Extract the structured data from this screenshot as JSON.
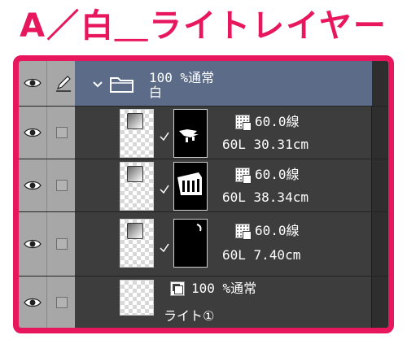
{
  "title": "A／白＿ライトレイヤー",
  "folder": {
    "opacity_blend": "100 %通常",
    "name": "白"
  },
  "layers": [
    {
      "line_width": "60.0線",
      "size_info": "60L 30.31cm"
    },
    {
      "line_width": "60.0線",
      "size_info": "60L 38.34cm"
    },
    {
      "line_width": "60.0線",
      "size_info": "60L 7.40cm"
    }
  ],
  "raster_layer": {
    "opacity_blend": "100 %通常",
    "name": "ライト①"
  },
  "colors": {
    "accent_frame": "#e8175d",
    "folder_row_bg": "#5b6b88",
    "panel_bg": "#3d3d3d",
    "column_bg": "#a7a7a7"
  },
  "icons": {
    "visibility": "eye-icon",
    "edit_lock": "pencil-icon",
    "folder": "folder-icon",
    "expand": "chevron-down-icon",
    "mask_enabled": "checkmark-icon",
    "vector_layer": "vector-layer-icon",
    "raster_layer": "raster-layer-icon"
  }
}
